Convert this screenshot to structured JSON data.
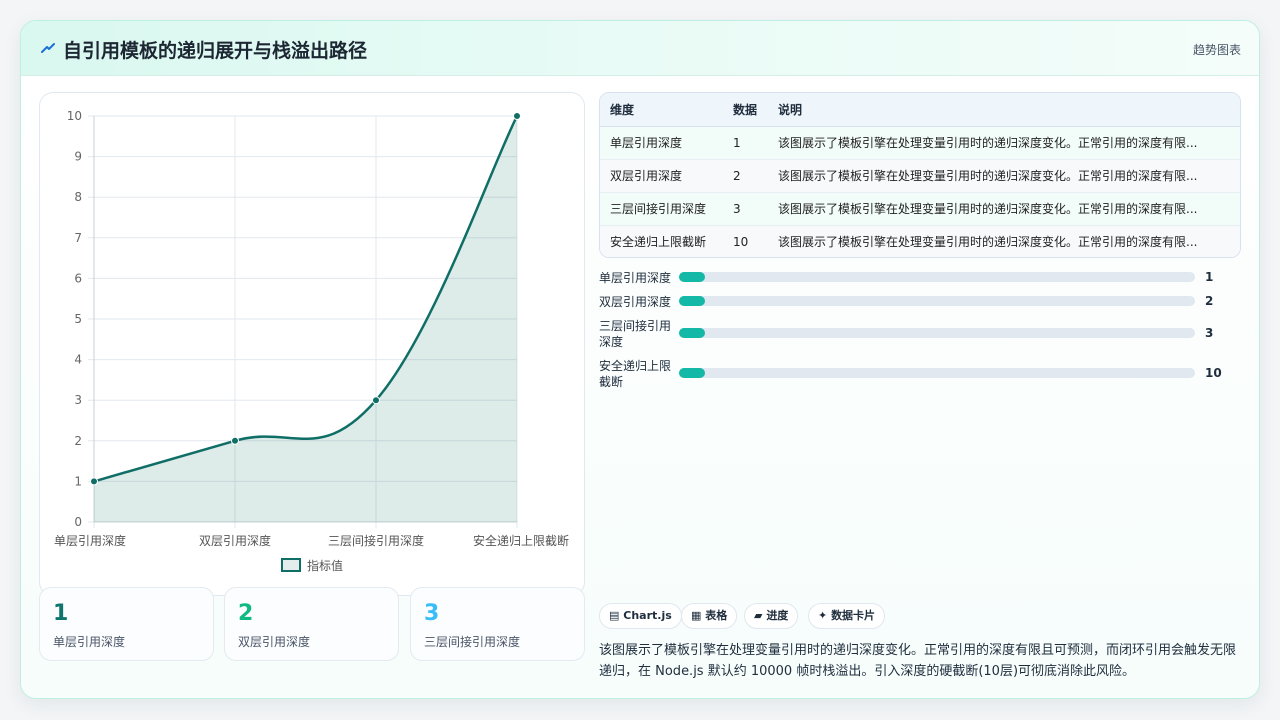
{
  "header": {
    "title": "自引用模板的递归展开与栈溢出路径",
    "type_label": "趋势图表"
  },
  "colors": {
    "line": "#0f6e66",
    "area": "rgba(15,110,102,0.14)",
    "stat1": "#0f766e",
    "stat2": "#10b981",
    "stat3": "#38bdf8",
    "progress": "#14b8a6"
  },
  "chart_data": {
    "type": "line",
    "categories": [
      "单层引用深度",
      "双层引用深度",
      "三层间接引用深度",
      "安全递归上限截断"
    ],
    "series": [
      {
        "name": "指标值",
        "values": [
          1,
          2,
          3,
          10
        ]
      }
    ],
    "ylim": [
      0,
      10
    ],
    "yticks": [
      0,
      1,
      2,
      3,
      4,
      5,
      6,
      7,
      8,
      9,
      10
    ],
    "grid": true,
    "legend": "bottom",
    "fill": true
  },
  "stats": [
    {
      "value": "1",
      "label": "单层引用深度"
    },
    {
      "value": "2",
      "label": "双层引用深度"
    },
    {
      "value": "3",
      "label": "三层间接引用深度"
    }
  ],
  "table": {
    "headers": [
      "维度",
      "数据",
      "说明"
    ],
    "rows": [
      {
        "dim": "单层引用深度",
        "val": "1",
        "note": "该图展示了模板引擎在处理变量引用时的递归深度变化。正常引用的深度有限..."
      },
      {
        "dim": "双层引用深度",
        "val": "2",
        "note": "该图展示了模板引擎在处理变量引用时的递归深度变化。正常引用的深度有限..."
      },
      {
        "dim": "三层间接引用深度",
        "val": "3",
        "note": "该图展示了模板引擎在处理变量引用时的递归深度变化。正常引用的深度有限..."
      },
      {
        "dim": "安全递归上限截断",
        "val": "10",
        "note": "该图展示了模板引擎在处理变量引用时的递归深度变化。正常引用的深度有限..."
      }
    ]
  },
  "progress": {
    "max": 200,
    "items": [
      {
        "label": "单层引用深度",
        "value": 1
      },
      {
        "label": "双层引用深度",
        "value": 2
      },
      {
        "label": "三层间接引用深度",
        "value": 3
      },
      {
        "label": "安全递归上限截断",
        "value": 10
      }
    ]
  },
  "tags": [
    {
      "icon": "chart-icon",
      "glyph": "▤",
      "label": "Chart.js"
    },
    {
      "icon": "table-icon",
      "glyph": "▦",
      "label": "表格"
    },
    {
      "icon": "progress-icon",
      "glyph": "▰",
      "label": "进度"
    },
    {
      "icon": "sparkle-icon",
      "glyph": "✦",
      "label": "数据卡片"
    }
  ],
  "description": "该图展示了模板引擎在处理变量引用时的递归深度变化。正常引用的深度有限且可预测，而闭环引用会触发无限递归，在 Node.js 默认约 10000 帧时栈溢出。引入深度的硬截断(10层)可彻底消除此风险。"
}
